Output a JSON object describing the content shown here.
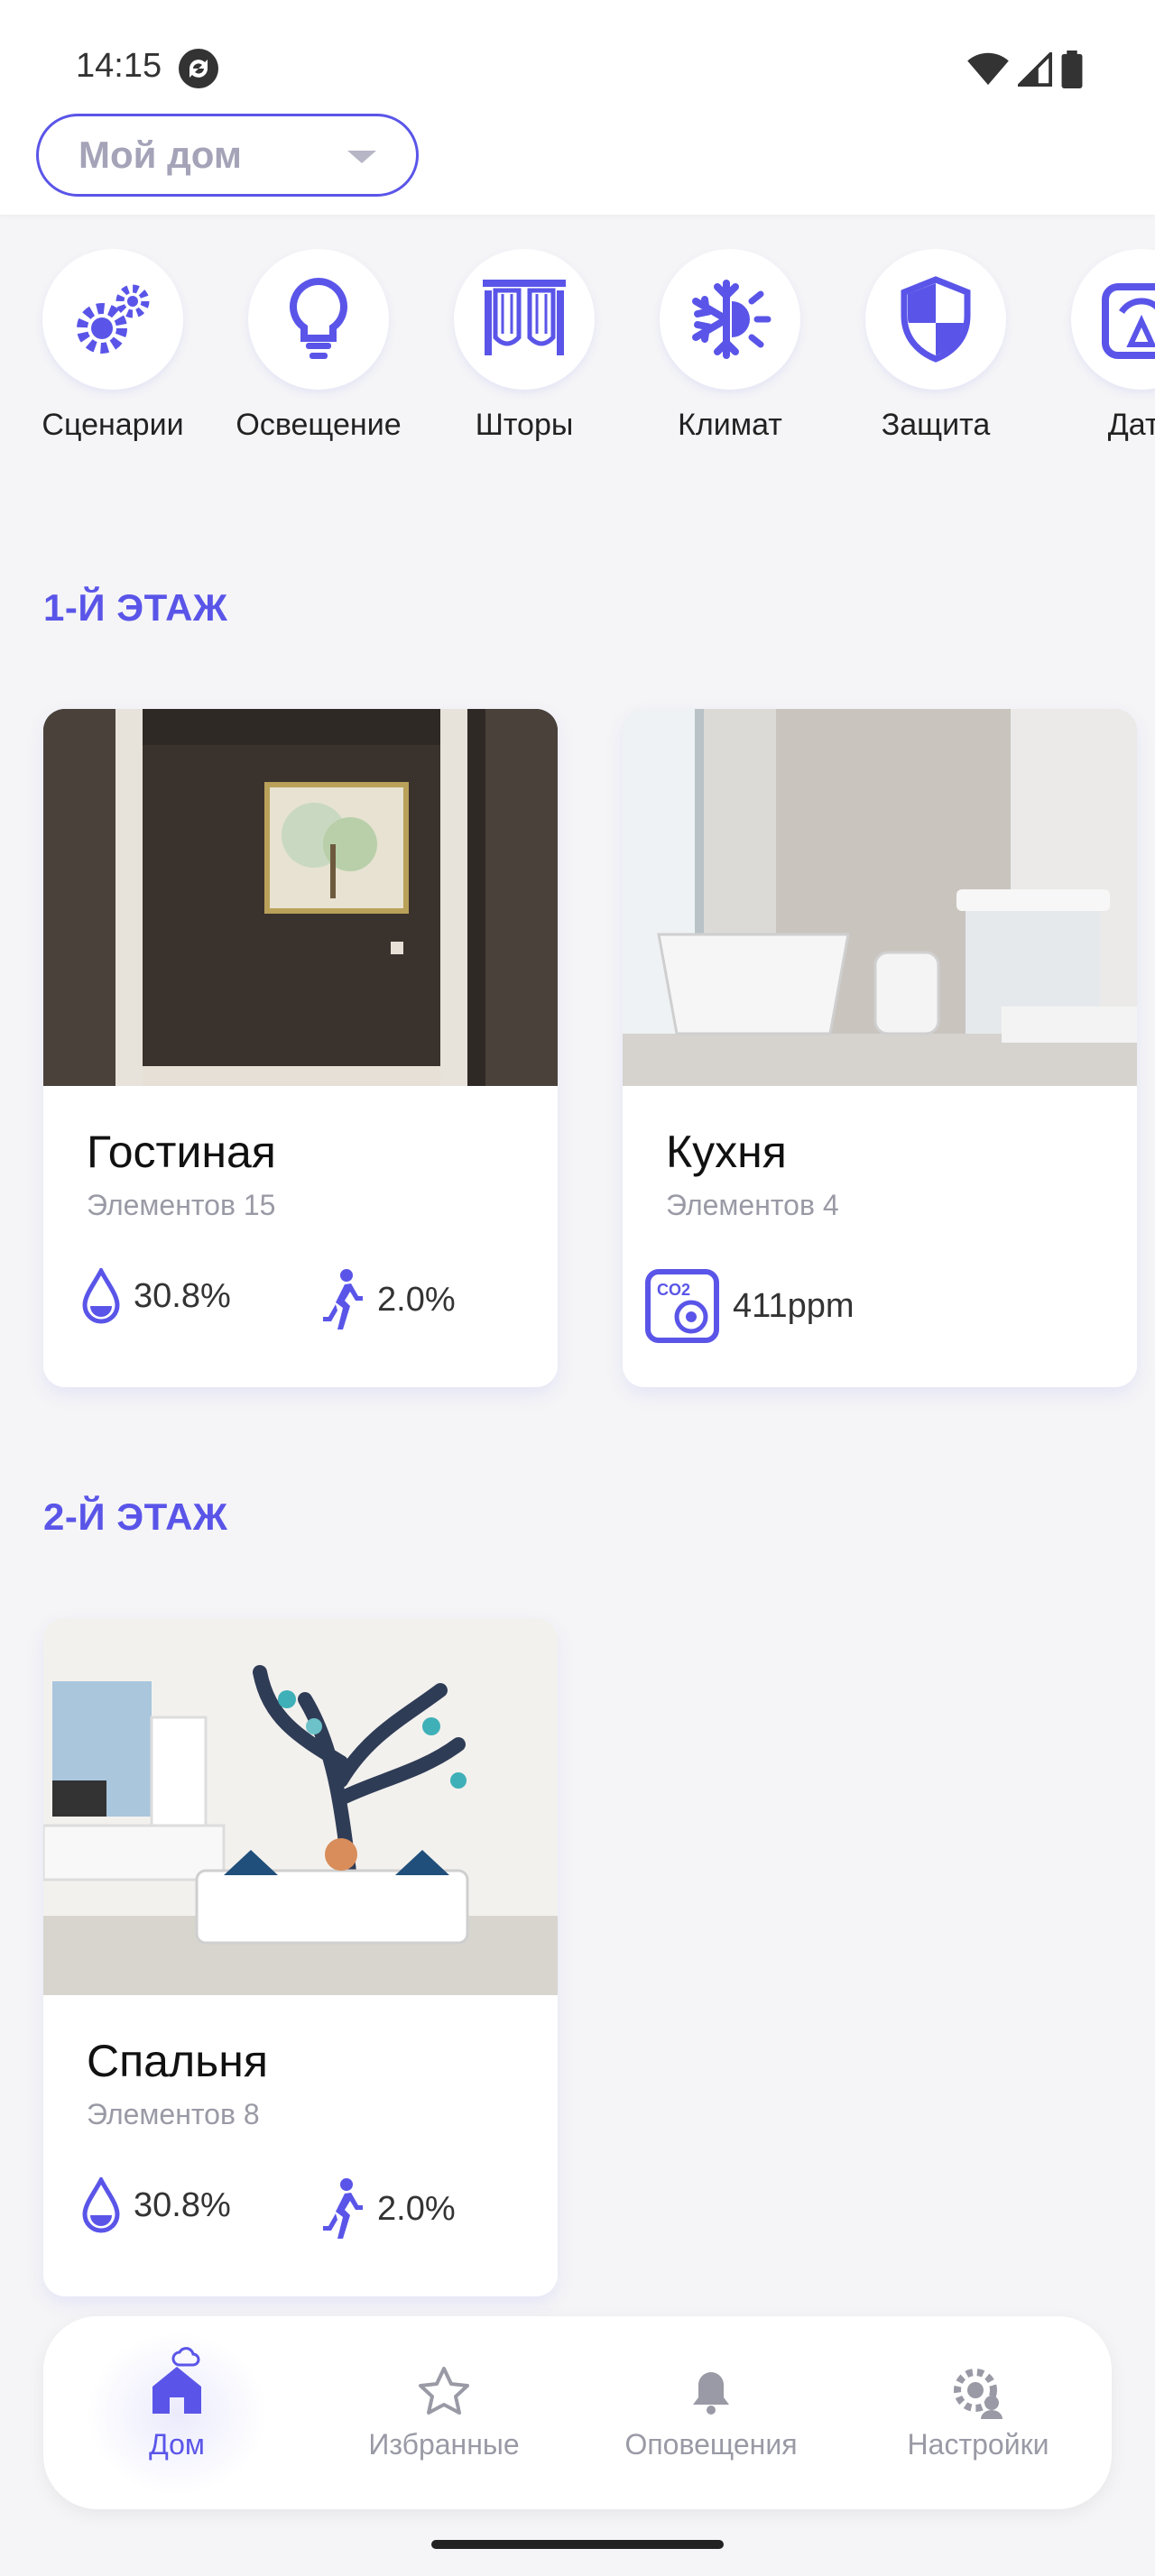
{
  "status_bar": {
    "time": "14:15"
  },
  "header": {
    "home_selector_value": "Мой дом"
  },
  "categories": [
    {
      "label": "Сценарии",
      "icon": "gears-icon"
    },
    {
      "label": "Освещение",
      "icon": "lightbulb-icon"
    },
    {
      "label": "Шторы",
      "icon": "curtains-icon"
    },
    {
      "label": "Климат",
      "icon": "climate-icon"
    },
    {
      "label": "Защита",
      "icon": "shield-icon"
    },
    {
      "label": "Датч",
      "icon": "sensor-icon"
    }
  ],
  "floors": [
    {
      "title": "1-Й ЭТАЖ",
      "rooms": [
        {
          "name": "Гостиная",
          "count": "Элементов 15",
          "humidity": "30.8%",
          "motion": "2.0%"
        },
        {
          "name": "Кухня",
          "count": "Элементов 4",
          "co2": "411ppm"
        }
      ]
    },
    {
      "title": "2-Й ЭТАЖ",
      "rooms": [
        {
          "name": "Спальня",
          "count": "Элементов 8",
          "humidity": "30.8%",
          "motion": "2.0%"
        }
      ]
    }
  ],
  "bottom_nav": [
    {
      "label": "Дом",
      "icon": "home-icon",
      "active": true
    },
    {
      "label": "Избранные",
      "icon": "star-icon"
    },
    {
      "label": "Оповещения",
      "icon": "bell-icon"
    },
    {
      "label": "Настройки",
      "icon": "settings-icon"
    }
  ],
  "colors": {
    "accent": "#5a55e8",
    "background": "#f5f5f7",
    "muted": "#9a9aa6"
  }
}
